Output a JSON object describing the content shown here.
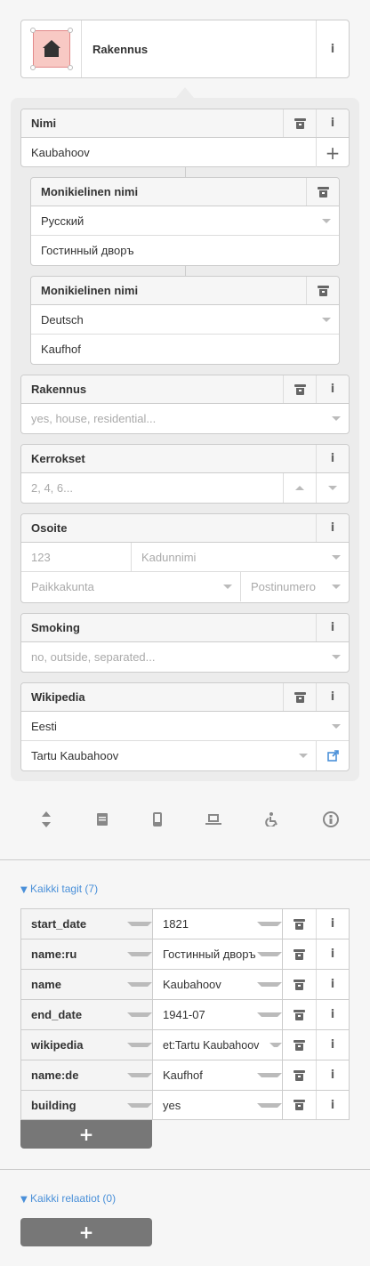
{
  "preset": {
    "name": "Rakennus",
    "icon": "building-icon",
    "info_icon": "info-icon"
  },
  "fields": {
    "name": {
      "label": "Nimi",
      "value": "Kaubahoov"
    },
    "multilingual": [
      {
        "label": "Monikielinen nimi",
        "language": "Русский",
        "value": "Гостинный дворъ"
      },
      {
        "label": "Monikielinen nimi",
        "language": "Deutsch",
        "value": "Kaufhof"
      }
    ],
    "building": {
      "label": "Rakennus",
      "placeholder": "yes, house, residential..."
    },
    "levels": {
      "label": "Kerrokset",
      "placeholder": "2, 4, 6..."
    },
    "address": {
      "label": "Osoite",
      "housenumber_placeholder": "123",
      "street_placeholder": "Kadunnimi",
      "city_placeholder": "Paikkakunta",
      "postcode_placeholder": "Postinumero"
    },
    "smoking": {
      "label": "Smoking",
      "placeholder": "no, outside, separated..."
    },
    "wikipedia": {
      "label": "Wikipedia",
      "language": "Eesti",
      "value": "Tartu Kaubahoov"
    }
  },
  "bottom_icons": [
    "resize-vertical-icon",
    "document-icon",
    "mobile-icon",
    "laptop-icon",
    "wheelchair-icon",
    "circle-info-icon"
  ],
  "all_tags": {
    "title": "Kaikki tagit (7)",
    "rows": [
      {
        "key": "start_date",
        "value": "1821"
      },
      {
        "key": "name:ru",
        "value": "Гостинный дворъ"
      },
      {
        "key": "name",
        "value": "Kaubahoov"
      },
      {
        "key": "end_date",
        "value": "1941-07"
      },
      {
        "key": "wikipedia",
        "value": "et:Tartu Kaubahoov"
      },
      {
        "key": "name:de",
        "value": "Kaufhof"
      },
      {
        "key": "building",
        "value": "yes"
      }
    ],
    "add_label": "+"
  },
  "all_relations": {
    "title": "Kaikki relaatiot (0)",
    "add_label": "+"
  },
  "colors": {
    "accent": "#4a90d9",
    "button_bg": "#777777",
    "panel_bg": "#ececec"
  }
}
